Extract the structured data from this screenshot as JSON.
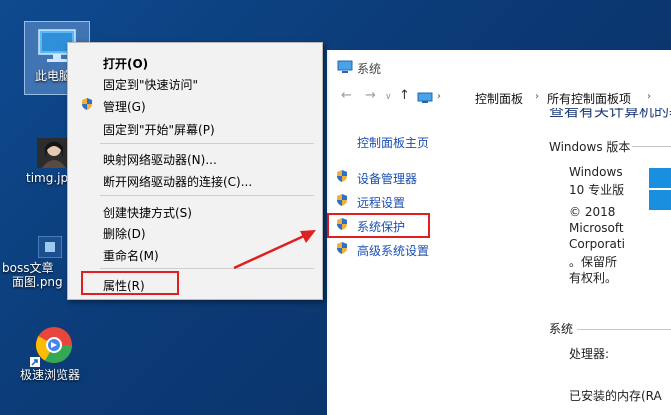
{
  "desktop": {
    "icons": [
      {
        "label": "此电脑"
      },
      {
        "label": "timg.jpg"
      },
      {
        "label_line1": "boss文章",
        "label_line2": "面图.png"
      },
      {
        "label": "极速浏览器"
      }
    ]
  },
  "context_menu": {
    "items": [
      {
        "label": "打开(O)"
      },
      {
        "label": "固定到\"快速访问\""
      },
      {
        "label": "管理(G)"
      },
      {
        "label": "固定到\"开始\"屏幕(P)"
      },
      {
        "label": "映射网络驱动器(N)..."
      },
      {
        "label": "断开网络驱动器的连接(C)..."
      },
      {
        "label": "创建快捷方式(S)"
      },
      {
        "label": "删除(D)"
      },
      {
        "label": "重命名(M)"
      },
      {
        "label": "属性(R)"
      }
    ]
  },
  "window": {
    "title": "系统",
    "breadcrumb": [
      "控制面板",
      "所有控制面板项"
    ],
    "sidebar": {
      "home": "控制面板主页",
      "links": [
        "设备管理器",
        "远程设置",
        "系统保护",
        "高级系统设置"
      ]
    },
    "main": {
      "heading_fragment": "查看有关计算机的基本信息",
      "edition_header": "Windows 版本",
      "edition_lines": [
        "Windows",
        "10 专业版"
      ],
      "copyright_lines": [
        "© 2018",
        "Microsoft",
        "Corporati",
        "。保留所",
        "有权利。"
      ],
      "system_header": "系统",
      "processor_label": "处理器:",
      "memory_label": "已安装的内存(RA"
    }
  },
  "colors": {
    "highlight": "#e02020",
    "link": "#1a4fb0",
    "desktop": "#0d3b78"
  }
}
